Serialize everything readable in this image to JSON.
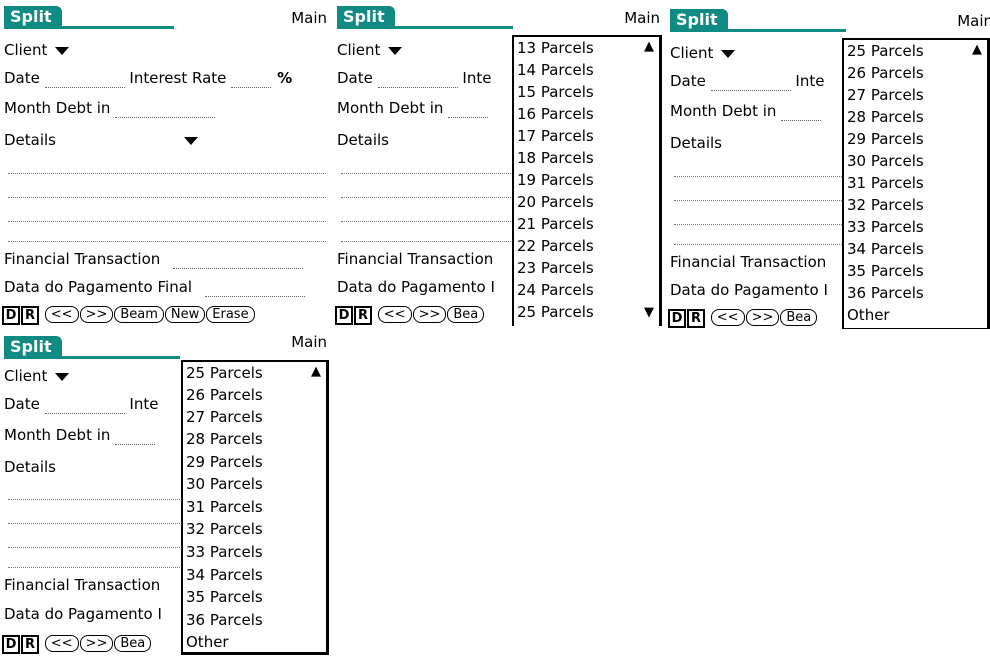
{
  "form": {
    "tab_title": "Split",
    "category": "Main",
    "client_label": "Client",
    "date_label": "Date",
    "interest_rate_label": "Interest Rate",
    "interest_rate_trunc": "Inte",
    "percent_symbol": "%",
    "month_debt_label": "Month Debt in",
    "details_label": "Details",
    "financial_transaction_label": "Financial Transaction",
    "final_payment_date_label": "Data do Pagamento Final",
    "final_payment_date_trunc": "Data do Pagamento I"
  },
  "buttons": {
    "d": "D",
    "r": "R",
    "prev": "<<",
    "next": ">>",
    "beam": "Beam",
    "beam_trunc": "Bea",
    "new": "New",
    "erase": "Erase"
  },
  "popup_lists": {
    "list_a": [
      "13 Parcels",
      "14 Parcels",
      "15 Parcels",
      "16 Parcels",
      "17 Parcels",
      "18 Parcels",
      "19 Parcels",
      "20 Parcels",
      "21 Parcels",
      "22 Parcels",
      "23 Parcels",
      "24 Parcels",
      "25 Parcels"
    ],
    "list_b": [
      "25 Parcels",
      "26 Parcels",
      "27 Parcels",
      "28 Parcels",
      "29 Parcels",
      "30 Parcels",
      "31 Parcels",
      "32 Parcels",
      "33 Parcels",
      "34 Parcels",
      "35 Parcels",
      "36 Parcels",
      "Other"
    ]
  },
  "icons": {
    "scroll_up": "arrow-up-icon",
    "scroll_down": "arrow-down-icon",
    "dropdown": "triangle-down-icon"
  }
}
